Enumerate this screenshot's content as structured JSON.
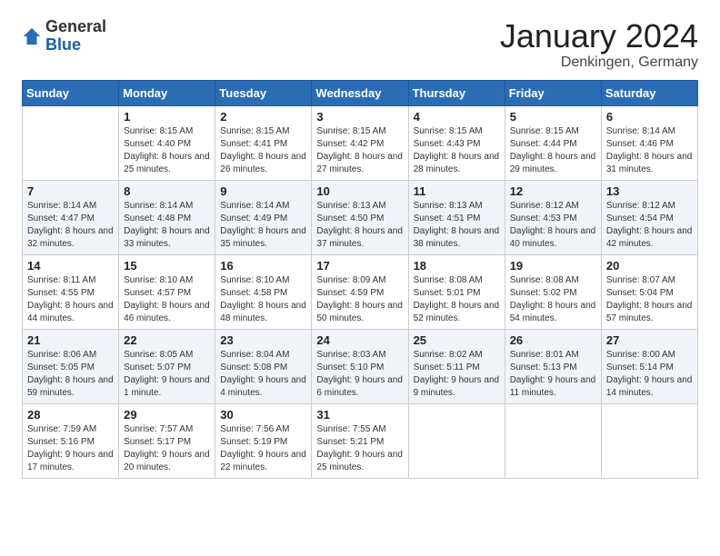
{
  "header": {
    "logo_general": "General",
    "logo_blue": "Blue",
    "month": "January 2024",
    "location": "Denkingen, Germany"
  },
  "days_header": [
    "Sunday",
    "Monday",
    "Tuesday",
    "Wednesday",
    "Thursday",
    "Friday",
    "Saturday"
  ],
  "weeks": [
    [
      {
        "day": "",
        "sunrise": "",
        "sunset": "",
        "daylight": ""
      },
      {
        "day": "1",
        "sunrise": "Sunrise: 8:15 AM",
        "sunset": "Sunset: 4:40 PM",
        "daylight": "Daylight: 8 hours and 25 minutes."
      },
      {
        "day": "2",
        "sunrise": "Sunrise: 8:15 AM",
        "sunset": "Sunset: 4:41 PM",
        "daylight": "Daylight: 8 hours and 26 minutes."
      },
      {
        "day": "3",
        "sunrise": "Sunrise: 8:15 AM",
        "sunset": "Sunset: 4:42 PM",
        "daylight": "Daylight: 8 hours and 27 minutes."
      },
      {
        "day": "4",
        "sunrise": "Sunrise: 8:15 AM",
        "sunset": "Sunset: 4:43 PM",
        "daylight": "Daylight: 8 hours and 28 minutes."
      },
      {
        "day": "5",
        "sunrise": "Sunrise: 8:15 AM",
        "sunset": "Sunset: 4:44 PM",
        "daylight": "Daylight: 8 hours and 29 minutes."
      },
      {
        "day": "6",
        "sunrise": "Sunrise: 8:14 AM",
        "sunset": "Sunset: 4:46 PM",
        "daylight": "Daylight: 8 hours and 31 minutes."
      }
    ],
    [
      {
        "day": "7",
        "sunrise": "Sunrise: 8:14 AM",
        "sunset": "Sunset: 4:47 PM",
        "daylight": "Daylight: 8 hours and 32 minutes."
      },
      {
        "day": "8",
        "sunrise": "Sunrise: 8:14 AM",
        "sunset": "Sunset: 4:48 PM",
        "daylight": "Daylight: 8 hours and 33 minutes."
      },
      {
        "day": "9",
        "sunrise": "Sunrise: 8:14 AM",
        "sunset": "Sunset: 4:49 PM",
        "daylight": "Daylight: 8 hours and 35 minutes."
      },
      {
        "day": "10",
        "sunrise": "Sunrise: 8:13 AM",
        "sunset": "Sunset: 4:50 PM",
        "daylight": "Daylight: 8 hours and 37 minutes."
      },
      {
        "day": "11",
        "sunrise": "Sunrise: 8:13 AM",
        "sunset": "Sunset: 4:51 PM",
        "daylight": "Daylight: 8 hours and 38 minutes."
      },
      {
        "day": "12",
        "sunrise": "Sunrise: 8:12 AM",
        "sunset": "Sunset: 4:53 PM",
        "daylight": "Daylight: 8 hours and 40 minutes."
      },
      {
        "day": "13",
        "sunrise": "Sunrise: 8:12 AM",
        "sunset": "Sunset: 4:54 PM",
        "daylight": "Daylight: 8 hours and 42 minutes."
      }
    ],
    [
      {
        "day": "14",
        "sunrise": "Sunrise: 8:11 AM",
        "sunset": "Sunset: 4:55 PM",
        "daylight": "Daylight: 8 hours and 44 minutes."
      },
      {
        "day": "15",
        "sunrise": "Sunrise: 8:10 AM",
        "sunset": "Sunset: 4:57 PM",
        "daylight": "Daylight: 8 hours and 46 minutes."
      },
      {
        "day": "16",
        "sunrise": "Sunrise: 8:10 AM",
        "sunset": "Sunset: 4:58 PM",
        "daylight": "Daylight: 8 hours and 48 minutes."
      },
      {
        "day": "17",
        "sunrise": "Sunrise: 8:09 AM",
        "sunset": "Sunset: 4:59 PM",
        "daylight": "Daylight: 8 hours and 50 minutes."
      },
      {
        "day": "18",
        "sunrise": "Sunrise: 8:08 AM",
        "sunset": "Sunset: 5:01 PM",
        "daylight": "Daylight: 8 hours and 52 minutes."
      },
      {
        "day": "19",
        "sunrise": "Sunrise: 8:08 AM",
        "sunset": "Sunset: 5:02 PM",
        "daylight": "Daylight: 8 hours and 54 minutes."
      },
      {
        "day": "20",
        "sunrise": "Sunrise: 8:07 AM",
        "sunset": "Sunset: 5:04 PM",
        "daylight": "Daylight: 8 hours and 57 minutes."
      }
    ],
    [
      {
        "day": "21",
        "sunrise": "Sunrise: 8:06 AM",
        "sunset": "Sunset: 5:05 PM",
        "daylight": "Daylight: 8 hours and 59 minutes."
      },
      {
        "day": "22",
        "sunrise": "Sunrise: 8:05 AM",
        "sunset": "Sunset: 5:07 PM",
        "daylight": "Daylight: 9 hours and 1 minute."
      },
      {
        "day": "23",
        "sunrise": "Sunrise: 8:04 AM",
        "sunset": "Sunset: 5:08 PM",
        "daylight": "Daylight: 9 hours and 4 minutes."
      },
      {
        "day": "24",
        "sunrise": "Sunrise: 8:03 AM",
        "sunset": "Sunset: 5:10 PM",
        "daylight": "Daylight: 9 hours and 6 minutes."
      },
      {
        "day": "25",
        "sunrise": "Sunrise: 8:02 AM",
        "sunset": "Sunset: 5:11 PM",
        "daylight": "Daylight: 9 hours and 9 minutes."
      },
      {
        "day": "26",
        "sunrise": "Sunrise: 8:01 AM",
        "sunset": "Sunset: 5:13 PM",
        "daylight": "Daylight: 9 hours and 11 minutes."
      },
      {
        "day": "27",
        "sunrise": "Sunrise: 8:00 AM",
        "sunset": "Sunset: 5:14 PM",
        "daylight": "Daylight: 9 hours and 14 minutes."
      }
    ],
    [
      {
        "day": "28",
        "sunrise": "Sunrise: 7:59 AM",
        "sunset": "Sunset: 5:16 PM",
        "daylight": "Daylight: 9 hours and 17 minutes."
      },
      {
        "day": "29",
        "sunrise": "Sunrise: 7:57 AM",
        "sunset": "Sunset: 5:17 PM",
        "daylight": "Daylight: 9 hours and 20 minutes."
      },
      {
        "day": "30",
        "sunrise": "Sunrise: 7:56 AM",
        "sunset": "Sunset: 5:19 PM",
        "daylight": "Daylight: 9 hours and 22 minutes."
      },
      {
        "day": "31",
        "sunrise": "Sunrise: 7:55 AM",
        "sunset": "Sunset: 5:21 PM",
        "daylight": "Daylight: 9 hours and 25 minutes."
      },
      {
        "day": "",
        "sunrise": "",
        "sunset": "",
        "daylight": ""
      },
      {
        "day": "",
        "sunrise": "",
        "sunset": "",
        "daylight": ""
      },
      {
        "day": "",
        "sunrise": "",
        "sunset": "",
        "daylight": ""
      }
    ]
  ]
}
